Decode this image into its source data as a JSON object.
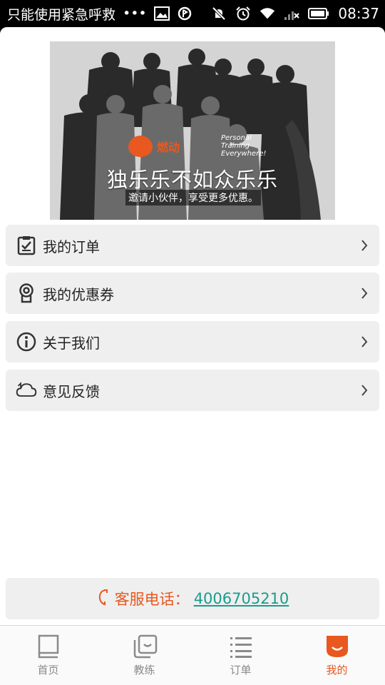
{
  "status_bar": {
    "notification_text": "只能使用紧急呼救",
    "dots": "•••",
    "time": "08:37"
  },
  "banner": {
    "brand": "燃动",
    "tagline": "Personal Training Everywhere!",
    "title": "独乐乐不如众乐乐",
    "subtitle": "邀请小伙伴，享受更多优惠。"
  },
  "menu": {
    "items": [
      {
        "label": "我的订单",
        "icon": "order-check-icon"
      },
      {
        "label": "我的优惠券",
        "icon": "coupon-badge-icon"
      },
      {
        "label": "关于我们",
        "icon": "info-icon"
      },
      {
        "label": "意见反馈",
        "icon": "feedback-cloud-icon"
      }
    ]
  },
  "service": {
    "label": "客服电话：",
    "phone": "4006705210"
  },
  "tabs": [
    {
      "label": "首页",
      "icon": "home-book-icon",
      "active": false
    },
    {
      "label": "教练",
      "icon": "coach-cards-icon",
      "active": false
    },
    {
      "label": "订单",
      "icon": "list-icon",
      "active": false
    },
    {
      "label": "我的",
      "icon": "profile-smile-icon",
      "active": true
    }
  ],
  "colors": {
    "accent": "#e8581f",
    "phone": "#1a9c8c",
    "inactive_tab": "#8a8a8a",
    "menu_bg": "#efefef"
  }
}
